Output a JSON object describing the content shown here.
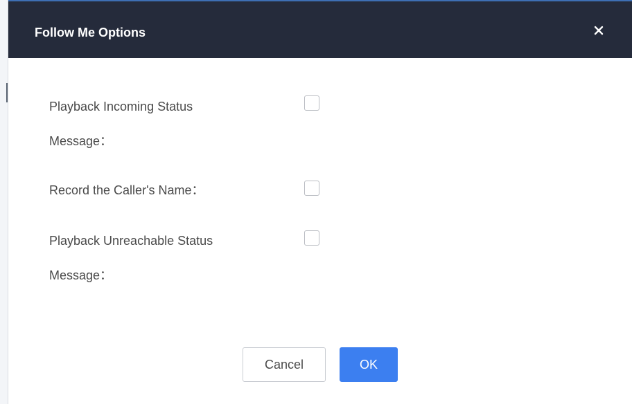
{
  "dialog": {
    "title": "Follow Me Options",
    "close_glyph": "✕"
  },
  "options": [
    {
      "label_line1": "Playback Incoming Status",
      "label_line2": "Message：",
      "checked": false
    },
    {
      "label_line1": "Record the Caller's Name：",
      "checked": false
    },
    {
      "label_line1": "Playback Unreachable Status",
      "label_line2": "Message：",
      "checked": false
    }
  ],
  "buttons": {
    "cancel_label": "Cancel",
    "ok_label": "OK"
  },
  "colors": {
    "header_bg": "#252b3b",
    "primary": "#3c7ff0",
    "border": "#c9ccd2"
  }
}
